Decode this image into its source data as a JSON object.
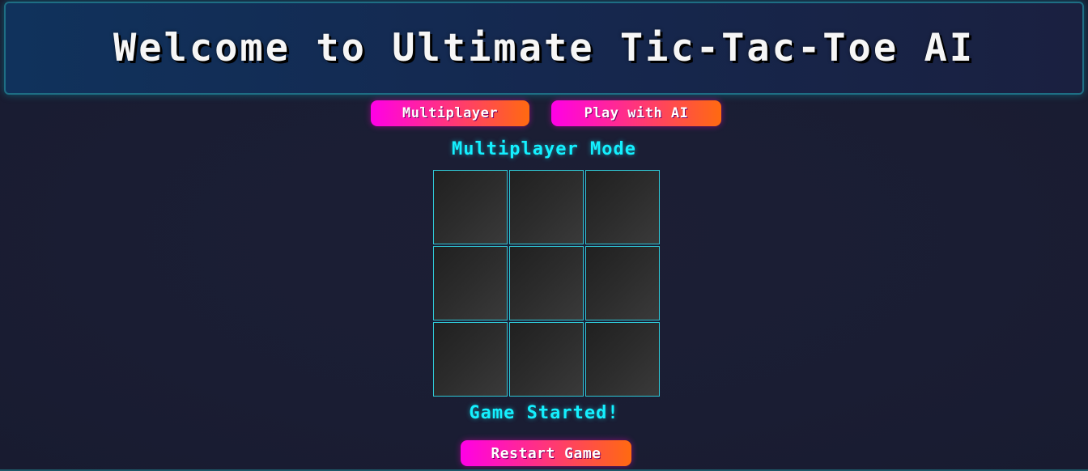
{
  "header": {
    "title": "Welcome to Ultimate Tic-Tac-Toe AI"
  },
  "mode_buttons": {
    "multiplayer_label": "Multiplayer",
    "ai_label": "Play with AI"
  },
  "game": {
    "mode_title": "Multiplayer Mode",
    "status": "Game Started!",
    "restart_label": "Restart Game",
    "cells": [
      "",
      "",
      "",
      "",
      "",
      "",
      "",
      "",
      ""
    ]
  },
  "colors": {
    "accent_cyan": "#14f0ff",
    "button_gradient_start": "#ff00e6",
    "button_gradient_end": "#ff6a10",
    "background": "#1a1d33",
    "header_background": "#10325c",
    "cell_border": "#2fc7d4"
  }
}
